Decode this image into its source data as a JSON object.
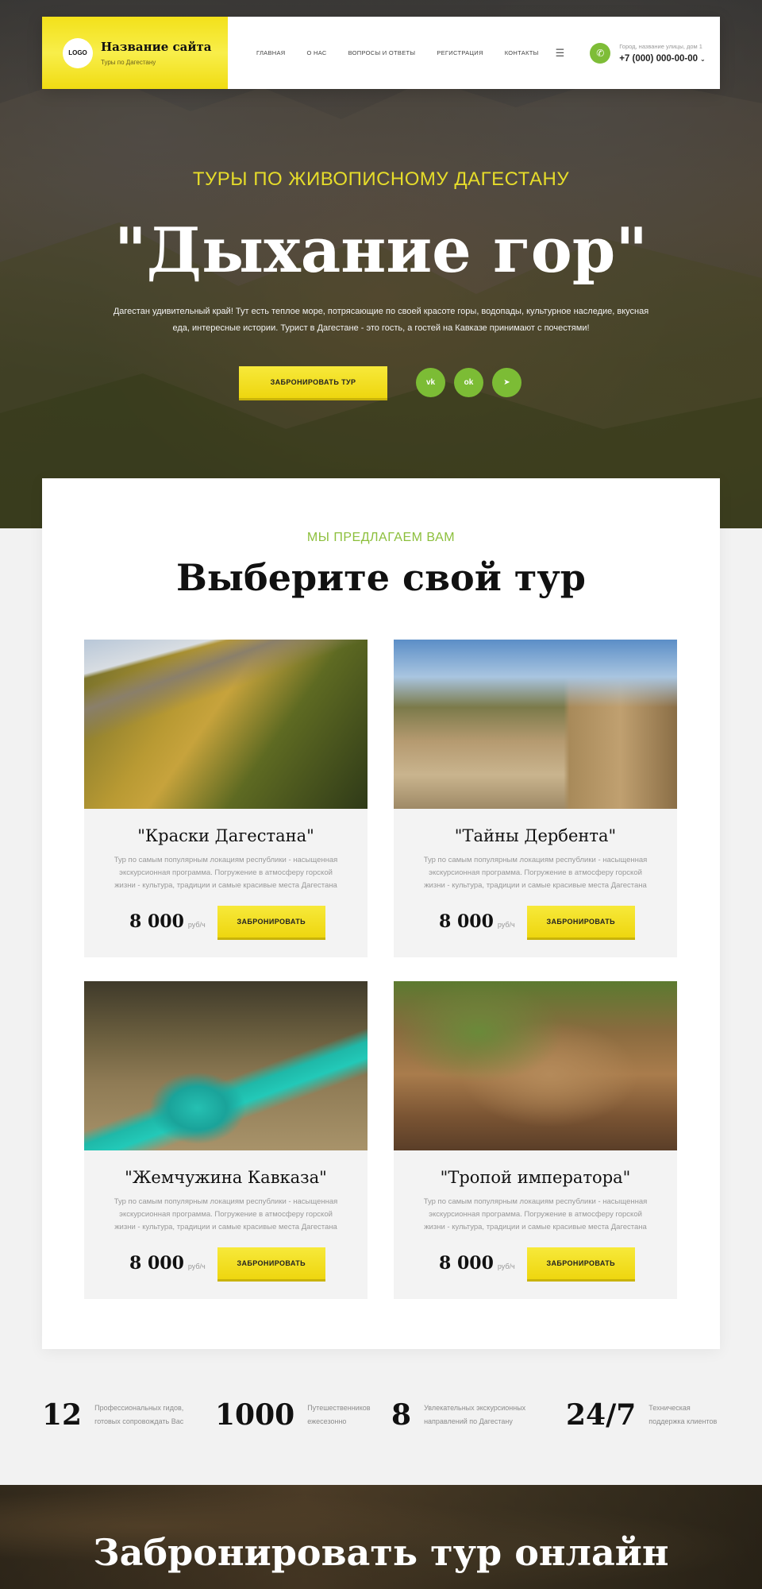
{
  "header": {
    "logo_text": "LOGO",
    "site_name": "Название сайта",
    "tagline": "Туры по Дагестану",
    "nav": [
      "ГЛАВНАЯ",
      "О НАС",
      "ВОПРОСЫ И ОТВЕТЫ",
      "РЕГИСТРАЦИЯ",
      "КОНТАКТЫ"
    ],
    "menu_icon": "☰",
    "address": "Город, название улицы, дом 1",
    "phone": "+7 (000) 000-00-00"
  },
  "hero": {
    "kicker": "ТУРЫ ПО ЖИВОПИСНОМУ ДАГЕСТАНУ",
    "title": "\"Дыхание гор\"",
    "description": "Дагестан удивительный край! Тут есть теплое море, потрясающие по своей красоте горы, водопады, культурное наследие, вкусная еда, интересные истории. Турист в Дагестане - это гость, а гостей на Кавказе принимают с почестями!",
    "cta": "ЗАБРОНИРОВАТЬ ТУР",
    "socials": [
      "vk",
      "ok",
      "telegram"
    ]
  },
  "tours": {
    "kicker": "МЫ ПРЕДЛАГАЕМ ВАМ",
    "title": "Выберите свой тур",
    "items": [
      {
        "title": "\"Краски Дагестана\"",
        "desc": "Тур по самым популярным локациям республики - насыщенная экскурсионная программа. Погружение в атмосферу горской жизни - культура, традиции и самые красивые места Дагестана",
        "price": "8 000",
        "unit": "руб/ч",
        "button": "ЗАБРОНИРОВАТЬ"
      },
      {
        "title": "\"Тайны Дербента\"",
        "desc": "Тур по самым популярным локациям республики - насыщенная экскурсионная программа. Погружение в атмосферу горской жизни - культура, традиции и самые красивые места Дагестана",
        "price": "8 000",
        "unit": "руб/ч",
        "button": "ЗАБРОНИРОВАТЬ"
      },
      {
        "title": "\"Жемчужина Кавказа\"",
        "desc": "Тур по самым популярным локациям республики - насыщенная экскурсионная программа. Погружение в атмосферу горской жизни - культура, традиции и самые красивые места Дагестана",
        "price": "8 000",
        "unit": "руб/ч",
        "button": "ЗАБРОНИРОВАТЬ"
      },
      {
        "title": "\"Тропой императора\"",
        "desc": "Тур по самым популярным локациям республики - насыщенная экскурсионная программа. Погружение в атмосферу горской жизни - культура, традиции и самые красивые места Дагестана",
        "price": "8 000",
        "unit": "руб/ч",
        "button": "ЗАБРОНИРОВАТЬ"
      }
    ]
  },
  "stats": [
    {
      "num": "12",
      "label": "Профессиональных гидов, готовых сопровождать Вас"
    },
    {
      "num": "1000",
      "label": "Путешественников ежесезонно"
    },
    {
      "num": "8",
      "label": "Увлекательных экскурсионных направлений по Дагестану"
    },
    {
      "num": "24/7",
      "label": "Техническая поддержка клиентов"
    }
  ],
  "banner": {
    "title": "Забронировать тур онлайн"
  },
  "colors": {
    "accent_yellow": "#f3e11a",
    "accent_green": "#7cbc35"
  }
}
